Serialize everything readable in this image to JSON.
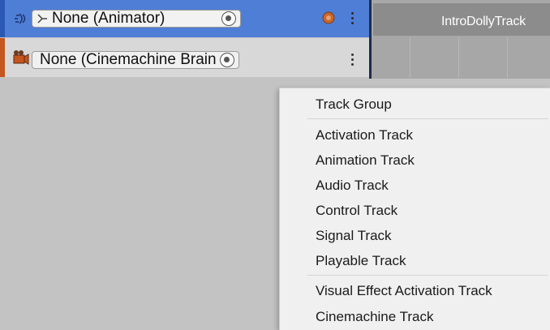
{
  "tracks": [
    {
      "field_text": "None (Animator)",
      "accent": "#2a58b3",
      "selected": true
    },
    {
      "field_text": "None (Cinemachine Brain",
      "accent": "#c4561f",
      "selected": false
    }
  ],
  "timeline": {
    "clip_label": "IntroDollyTrack"
  },
  "menu": {
    "groups": [
      [
        "Track Group"
      ],
      [
        "Activation Track",
        "Animation Track",
        "Audio Track",
        "Control Track",
        "Signal Track",
        "Playable Track"
      ],
      [
        "Visual Effect Activation Track",
        "Cinemachine Track"
      ]
    ]
  },
  "icons": {
    "animator_track": "animator-track-icon",
    "cinemachine_track": "cinemachine-track-icon",
    "animator_field": "animator-field-icon",
    "object_picker": "object-picker-icon",
    "record": "record-icon",
    "more": "more-options-icon"
  }
}
